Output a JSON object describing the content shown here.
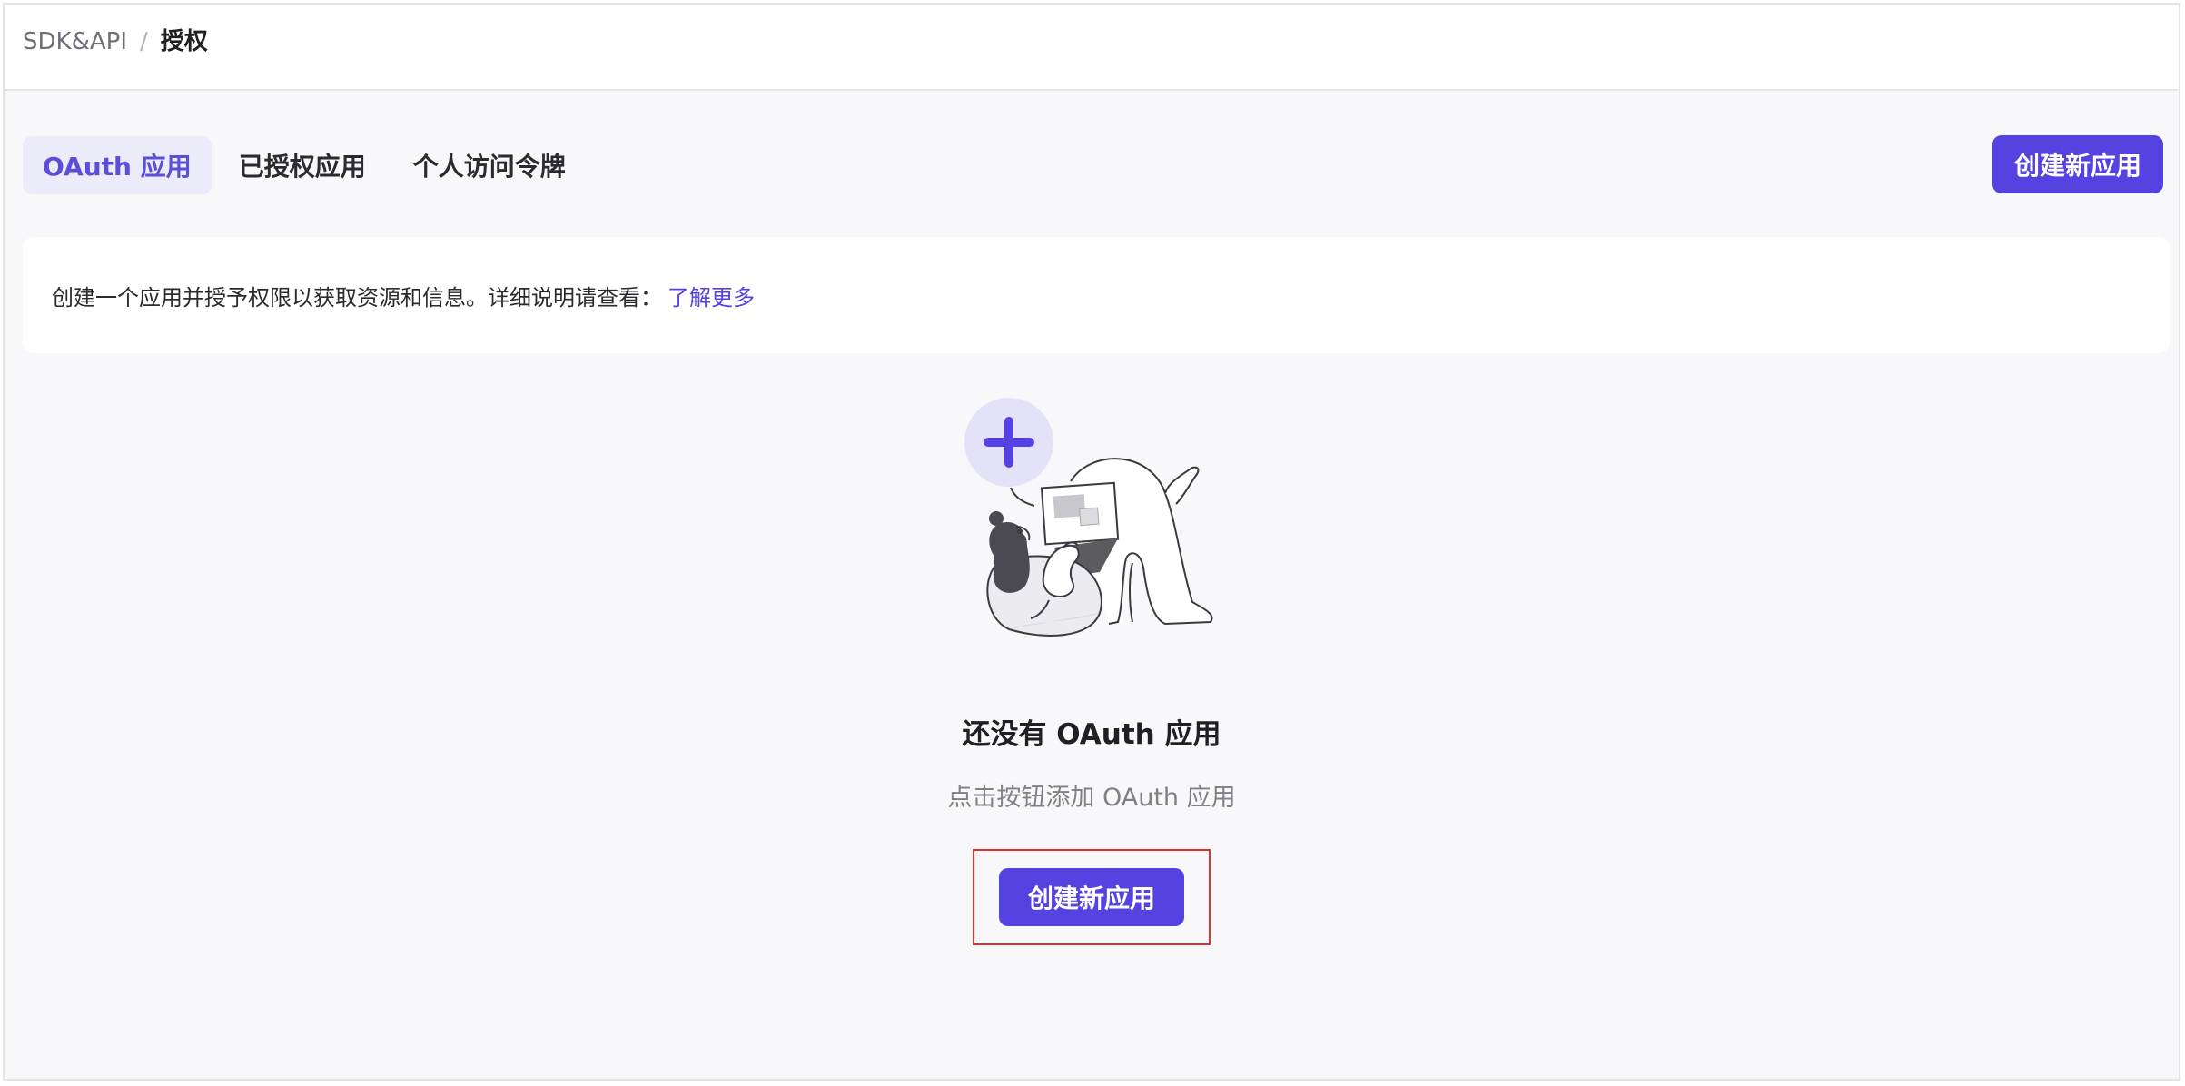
{
  "breadcrumb": {
    "root": "SDK&API",
    "separator": "/",
    "current": "授权"
  },
  "tabs": [
    {
      "label": "OAuth 应用",
      "active": true
    },
    {
      "label": "已授权应用",
      "active": false
    },
    {
      "label": "个人访问令牌",
      "active": false
    }
  ],
  "header_actions": {
    "create_label": "创建新应用"
  },
  "info": {
    "text": "创建一个应用并授予权限以获取资源和信息。详细说明请查看：",
    "link_label": "了解更多"
  },
  "empty_state": {
    "title": "还没有 OAuth 应用",
    "subtitle": "点击按钮添加 OAuth 应用",
    "create_label": "创建新应用",
    "illustration_icon": "person-with-laptop-illustration",
    "plus_icon": "plus-icon"
  },
  "colors": {
    "accent": "#5443e0",
    "accent_soft": "#ebebfa",
    "highlight": "#e0322f",
    "background": "#f8f8fa"
  }
}
